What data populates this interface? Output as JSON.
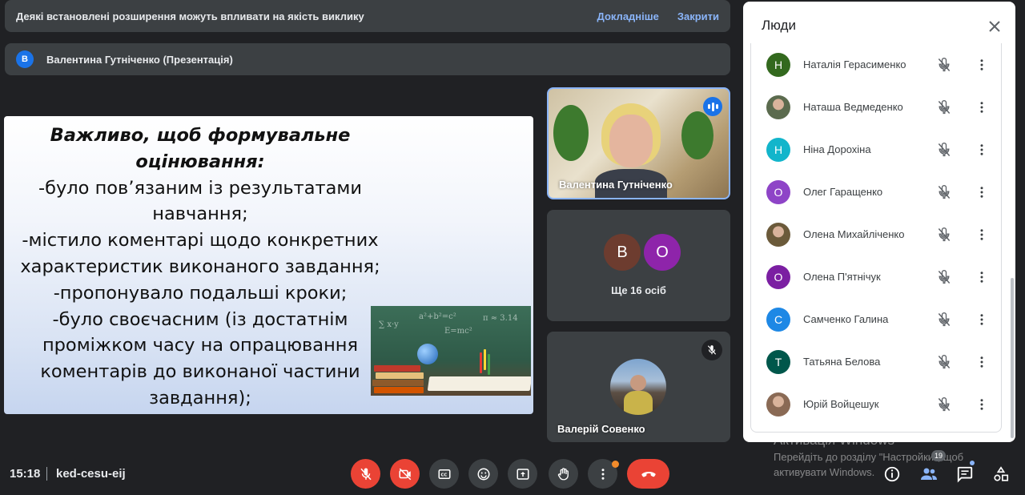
{
  "notice": {
    "message": "Деякі встановлені розширення можуть впливати на якість виклику",
    "details_link": "Докладніше",
    "close_link": "Закрити"
  },
  "presenter": {
    "initial": "В",
    "title": "Валентина Гутніченко (Презентація)"
  },
  "slide": {
    "heading_lines": [
      "Важливо, щоб формувальне",
      "оцінювання:"
    ],
    "body_lines": [
      "-було пов’язаним із результатами",
      "навчання;",
      "-містило коментарі щодо конкретних",
      "характеристик виконаного завдання;",
      "-пропонувало подальші кроки;",
      "-було своєчасним (із достатнім",
      "проміжком часу на опрацювання",
      "коментарів до виконаної частини",
      "завдання);"
    ]
  },
  "tiles": {
    "speaker_name": "Валентина Гутніченко",
    "more_avatars": [
      {
        "initial": "В",
        "color": "#6d3c2f"
      },
      {
        "initial": "О",
        "color": "#8e24aa"
      }
    ],
    "more_label": "Ще 16 осіб",
    "valerii_name": "Валерій Совенко"
  },
  "people_panel": {
    "title": "Люди",
    "participants": [
      {
        "name": "Наталія Герасименко",
        "initial": "Н",
        "color": "#33691e",
        "photo": false
      },
      {
        "name": "Наташа Ведмеденко",
        "initial": "",
        "color": "#5b6b4e",
        "photo": true
      },
      {
        "name": "Ніна Дорохіна",
        "initial": "Н",
        "color": "#12b5cb",
        "photo": false
      },
      {
        "name": "Олег Гаращенко",
        "initial": "О",
        "color": "#8e44c7",
        "photo": false
      },
      {
        "name": "Олена Михайліченко",
        "initial": "",
        "color": "#6b5a3a",
        "photo": true
      },
      {
        "name": "Олена П'ятнічук",
        "initial": "О",
        "color": "#7b1fa2",
        "photo": false
      },
      {
        "name": "Самченко Галина",
        "initial": "С",
        "color": "#1e88e5",
        "photo": false
      },
      {
        "name": "Татьяна Белова",
        "initial": "Т",
        "color": "#00574b",
        "photo": false
      },
      {
        "name": "Юрій Войцешук",
        "initial": "",
        "color": "#8a6a55",
        "photo": true
      }
    ]
  },
  "watermark": {
    "title": "Активація Windows",
    "line1": "Перейдіть до розділу \"Настройки\", щоб",
    "line2": "активувати Windows."
  },
  "bottom": {
    "time": "15:18",
    "meeting_code": "ked-cesu-eij",
    "participants_count": "19"
  },
  "colors": {
    "accent": "#8ab4f8",
    "danger": "#ea4335",
    "control_bg": "#3c4043"
  }
}
